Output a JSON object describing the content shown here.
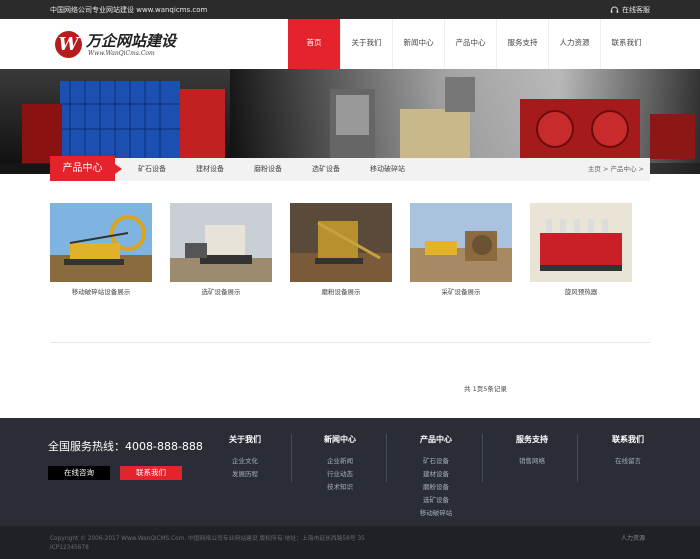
{
  "topbar": {
    "slogan": "中国网络公司专业网站建设 www.wanqicms.com",
    "service": "在线客服",
    "service_icon": "headset-icon"
  },
  "logo": {
    "mark": "W",
    "name": "万企网站建设",
    "url": "Www.WanQiCms.Com"
  },
  "nav": {
    "items": [
      "首页",
      "关于我们",
      "新闻中心",
      "产品中心",
      "服务支持",
      "人力资源",
      "联系我们"
    ],
    "active_index": 0
  },
  "subnav": {
    "title": "产品中心",
    "categories": [
      "矿石设备",
      "建材设备",
      "磨粉设备",
      "选矿设备",
      "移动破碎站"
    ],
    "breadcrumb": "主页 > 产品中心 >"
  },
  "products": [
    {
      "label": "移动破碎站设备展示"
    },
    {
      "label": "选矿设备展示"
    },
    {
      "label": "磨粉设备展示"
    },
    {
      "label": "采矿设备展示"
    },
    {
      "label": "旋风预热器"
    }
  ],
  "pager": "共 1页5条记录",
  "footer": {
    "hotline": "全国服务热线：4008-888-888",
    "consult_label": "在线咨询",
    "contact_label": "联系我们",
    "columns": [
      {
        "title": "关于我们",
        "links": [
          "企业文化",
          "发展历程"
        ]
      },
      {
        "title": "新闻中心",
        "links": [
          "企业新闻",
          "行业动态",
          "技术知识"
        ]
      },
      {
        "title": "产品中心",
        "links": [
          "矿石设备",
          "建材设备",
          "磨粉设备",
          "选矿设备",
          "移动破碎站"
        ]
      },
      {
        "title": "服务支持",
        "links": [
          "销售网络"
        ]
      },
      {
        "title": "联系我们",
        "links": [
          "在线留言"
        ]
      }
    ]
  },
  "copyright": {
    "line1": "Copyright © 2006-2017 Www.WanQiCMS.Com. 中国网络公司专业网站建设 版权所有   地址：上海市延长西路58号   35",
    "line2": "ICP12345678",
    "right": "人力资源"
  },
  "colors": {
    "accent": "#e4232c",
    "topbar": "#2b2b2b",
    "footer": "#2a2d35",
    "copyright_bg": "#1f2127"
  }
}
